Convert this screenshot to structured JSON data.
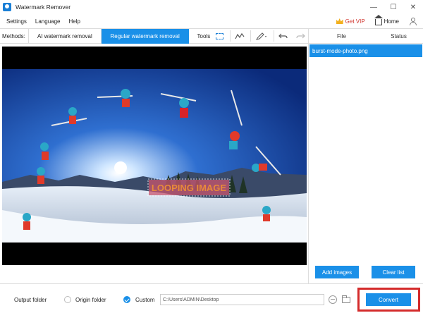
{
  "window": {
    "title": "Watermark Remover",
    "minimize": "—",
    "maximize": "☐",
    "close": "✕"
  },
  "menu": {
    "items": [
      "Settings",
      "Language",
      "Help"
    ],
    "vip": "Get VIP",
    "home": "Home"
  },
  "methods": {
    "label": "Methods:",
    "ai": "AI watermark removal",
    "regular": "Regular watermark removal",
    "tools_label": "Tools"
  },
  "file_list": {
    "headers": {
      "file": "File",
      "status": "Status"
    },
    "files": [
      {
        "name": "burst-mode-photo.png",
        "status": ""
      }
    ],
    "add_images": "Add images",
    "clear_list": "Clear list"
  },
  "preview": {
    "watermark_text": "LOOPING IMAGE"
  },
  "output": {
    "label": "Output folder",
    "origin_label": "Origin folder",
    "custom_label": "Custom",
    "selected": "custom",
    "path": "C:\\Users\\ADMIN\\Desktop",
    "convert": "Convert"
  },
  "colors": {
    "accent": "#1a90e8",
    "highlight": "#d42b2b",
    "vip": "#d0332c"
  }
}
